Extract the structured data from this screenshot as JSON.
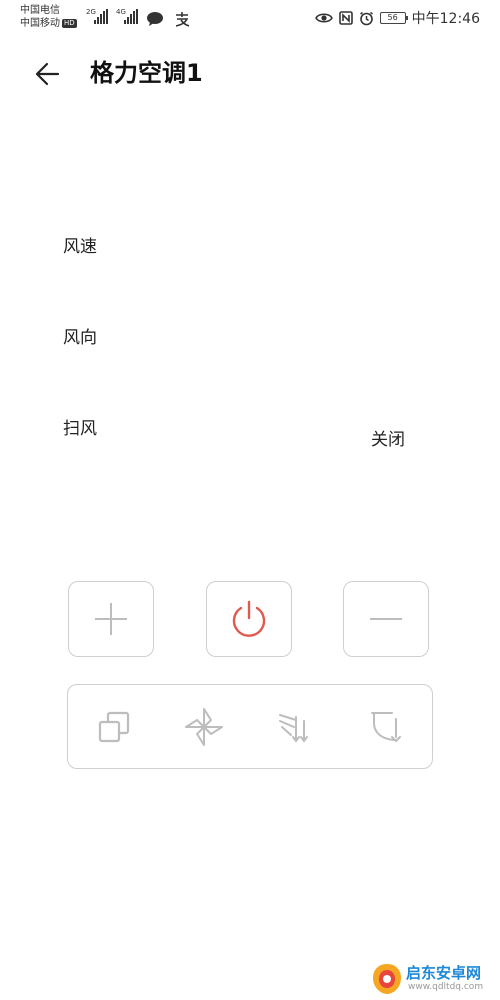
{
  "status_bar": {
    "carrier_1": "中国电信",
    "carrier_2": "中国移动",
    "hd": "HD",
    "signal_1": "2G",
    "signal_2": "4G",
    "battery": "56",
    "time": "中午12:46"
  },
  "header": {
    "title": "格力空调1"
  },
  "rows": {
    "fan_speed": {
      "label": "风速"
    },
    "direction": {
      "label": "风向"
    },
    "swing": {
      "label": "扫风",
      "value": "关闭"
    }
  },
  "controls": {
    "plus_icon": "plus-icon",
    "power_icon": "power-icon",
    "minus_icon": "minus-icon",
    "power_color": "#e05a4f"
  },
  "mode_bar": {
    "icons": [
      "copy-icon",
      "fan-icon",
      "wind-direction-icon",
      "swing-icon"
    ]
  },
  "watermark": {
    "text": "启东安卓网",
    "url": "www.qdltdq.com"
  }
}
